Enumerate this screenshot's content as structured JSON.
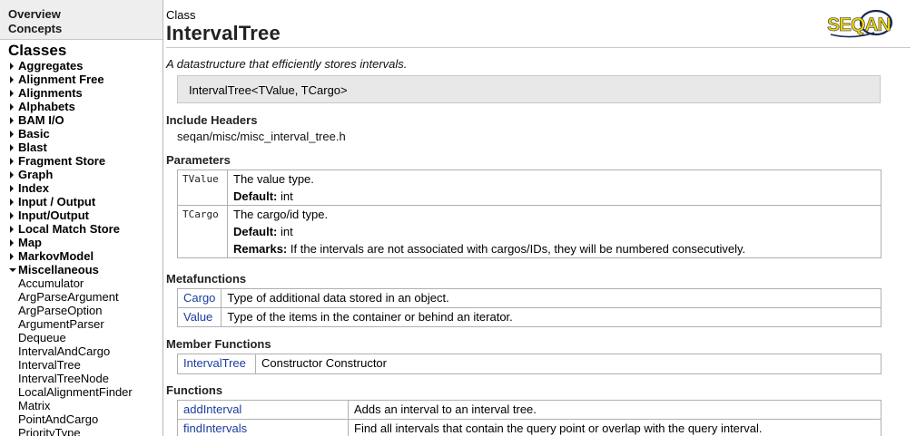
{
  "sidebar": {
    "nav": [
      "Overview",
      "Concepts"
    ],
    "section_title": "Classes",
    "categories": [
      {
        "label": "Aggregates",
        "expanded": false
      },
      {
        "label": "Alignment Free",
        "expanded": false
      },
      {
        "label": "Alignments",
        "expanded": false
      },
      {
        "label": "Alphabets",
        "expanded": false
      },
      {
        "label": "BAM I/O",
        "expanded": false
      },
      {
        "label": "Basic",
        "expanded": false
      },
      {
        "label": "Blast",
        "expanded": false
      },
      {
        "label": "Fragment Store",
        "expanded": false
      },
      {
        "label": "Graph",
        "expanded": false
      },
      {
        "label": "Index",
        "expanded": false
      },
      {
        "label": "Input / Output",
        "expanded": false
      },
      {
        "label": "Input/Output",
        "expanded": false
      },
      {
        "label": "Local Match Store",
        "expanded": false
      },
      {
        "label": "Map",
        "expanded": false
      },
      {
        "label": "MarkovModel",
        "expanded": false
      },
      {
        "label": "Miscellaneous",
        "expanded": true
      }
    ],
    "sub_items": [
      "Accumulator",
      "ArgParseArgument",
      "ArgParseOption",
      "ArgumentParser",
      "Dequeue",
      "IntervalAndCargo",
      "IntervalTree",
      "IntervalTreeNode",
      "LocalAlignmentFinder",
      "Matrix",
      "PointAndCargo",
      "PriorityType"
    ]
  },
  "main": {
    "kind": "Class",
    "title": "IntervalTree",
    "logo_text": "SEQAN",
    "description": "A datastructure that efficiently stores intervals.",
    "signature": "IntervalTree<TValue, TCargo>",
    "include_headers": {
      "heading": "Include Headers",
      "path": "seqan/misc/misc_interval_tree.h"
    },
    "parameters": {
      "heading": "Parameters",
      "default_label": "Default:",
      "remarks_label": "Remarks:",
      "rows": [
        {
          "name": "TValue",
          "desc": "The value type.",
          "default": "int"
        },
        {
          "name": "TCargo",
          "desc": "The cargo/id type.",
          "default": "int",
          "remarks": "If the intervals are not associated with cargos/IDs, they will be numbered consecutively."
        }
      ]
    },
    "metafunctions": {
      "heading": "Metafunctions",
      "rows": [
        {
          "name": "Cargo",
          "desc": "Type of additional data stored in an object."
        },
        {
          "name": "Value",
          "desc": "Type of the items in the container or behind an iterator."
        }
      ]
    },
    "member_functions": {
      "heading": "Member Functions",
      "rows": [
        {
          "name": "IntervalTree",
          "desc": "Constructor Constructor"
        }
      ]
    },
    "functions": {
      "heading": "Functions",
      "rows": [
        {
          "name": "addInterval",
          "desc": "Adds an interval to an interval tree."
        },
        {
          "name": "findIntervals",
          "desc": "Find all intervals that contain the query point or overlap with the query interval."
        }
      ]
    }
  },
  "colors": {
    "link": "#1a3c9e",
    "signature_bg": "#e8e8e8",
    "nav_bg": "#eeeeee",
    "logo_yellow": "#f2d500"
  }
}
